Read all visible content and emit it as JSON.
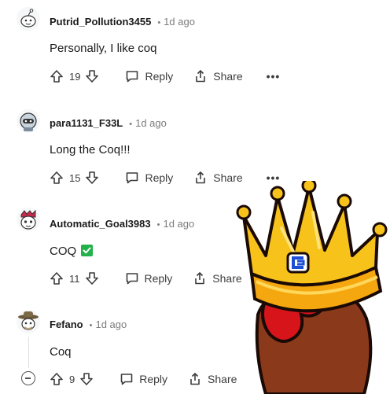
{
  "comments": [
    {
      "username": "Putrid_Pollution3455",
      "time": "1d ago",
      "body": "Personally, I like coq",
      "votes": "19",
      "reply_label": "Reply",
      "share_label": "Share",
      "more_label": "•••"
    },
    {
      "username": "para1131_F33L",
      "time": "1d ago",
      "body": "Long the Coq!!!",
      "votes": "15",
      "reply_label": "Reply",
      "share_label": "Share",
      "more_label": "•••"
    },
    {
      "username": "Automatic_Goal3983",
      "time": "1d ago",
      "body": "COQ",
      "votes": "11",
      "reply_label": "Reply",
      "share_label": "Share",
      "more_label": "•••"
    },
    {
      "username": "Fefano",
      "time": "1d ago",
      "body": "Coq",
      "votes": "9",
      "reply_label": "Reply",
      "share_label": "Share"
    }
  ],
  "meta_separator": "•",
  "colors": {
    "check_green": "#22b14c",
    "crown_gold": "#f5b90f",
    "body_brown": "#8a3a1a",
    "wattle_red": "#d8141b"
  },
  "icons": [
    "upvote-icon",
    "downvote-icon",
    "reply-icon",
    "share-icon",
    "checkmark-icon",
    "collapse-icon",
    "crown-sticker"
  ]
}
